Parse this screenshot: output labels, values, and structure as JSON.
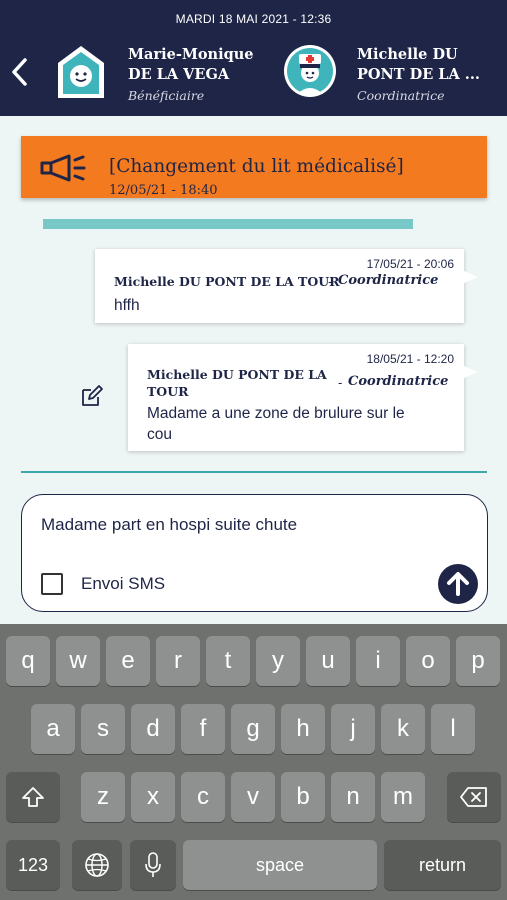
{
  "status_bar": {
    "datetime": "MARDI 18 MAI 2021 - 12:36"
  },
  "header": {
    "beneficiary": {
      "name_line1": "Marie-Monique",
      "name_line2": "DE LA VEGA",
      "role": "Bénéficiaire"
    },
    "coordinator": {
      "name_line1": "Michelle DU",
      "name_line2": "PONT DE LA ...",
      "role": "Coordinatrice"
    }
  },
  "event": {
    "title": "[Changement du lit médicalisé]",
    "datetime": "12/05/21 - 18:40"
  },
  "messages": [
    {
      "datetime": "17/05/21 - 20:06",
      "author": "Michelle DU PONT DE LA TOUR",
      "dash": "-",
      "role": "Coordinatrice",
      "text": "hffh"
    },
    {
      "datetime": "18/05/21 - 12:20",
      "author_line1": "Michelle DU PONT DE LA",
      "author_line2": "TOUR",
      "dash": "-",
      "role": "Coordinatrice",
      "text_line1": "Madame a une zone de brulure sur le",
      "text_line2": "cou"
    }
  ],
  "composer": {
    "text": "Madame part en hospi suite chute",
    "sms_label": "Envoi SMS",
    "sms_checked": false
  },
  "keyboard": {
    "row1": [
      "q",
      "w",
      "e",
      "r",
      "t",
      "y",
      "u",
      "i",
      "o",
      "p"
    ],
    "row2": [
      "a",
      "s",
      "d",
      "f",
      "g",
      "h",
      "j",
      "k",
      "l"
    ],
    "row3": [
      "z",
      "x",
      "c",
      "v",
      "b",
      "n",
      "m"
    ],
    "numbers_label": "123",
    "space_label": "space",
    "return_label": "return"
  },
  "colors": {
    "navy": "#1f2547",
    "orange": "#f47a1f",
    "teal": "#3fa9a9",
    "light_teal": "#78c8c7",
    "background": "#eef5f5"
  },
  "icons": [
    "back-chevron-icon",
    "house-face-icon",
    "nurse-avatar-icon",
    "megaphone-icon",
    "edit-icon",
    "send-arrow-icon",
    "shift-icon",
    "backspace-icon",
    "globe-icon",
    "microphone-icon"
  ]
}
